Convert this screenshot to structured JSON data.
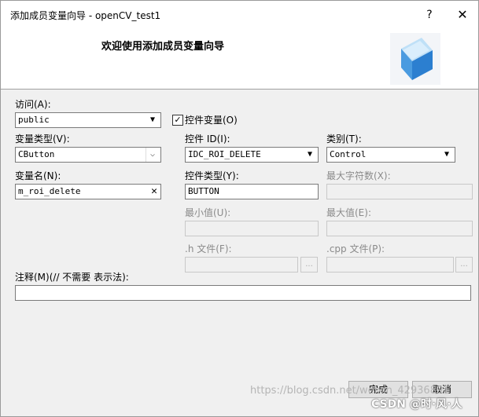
{
  "window": {
    "title": "添加成员变量向导 - openCV_test1",
    "help_label": "?",
    "close_label": "✕"
  },
  "header": {
    "title": "欢迎使用添加成员变量向导",
    "image_icon": "wizard-cube-icon"
  },
  "form": {
    "access": {
      "label": "访问(A):",
      "value": "public"
    },
    "control_variable": {
      "label": "控件变量(O)",
      "checked": true
    },
    "variable_type": {
      "label": "变量类型(V):",
      "value": "CButton"
    },
    "control_id": {
      "label": "控件 ID(I):",
      "value": "IDC_ROI_DELETE"
    },
    "category": {
      "label": "类别(T):",
      "value": "Control"
    },
    "variable_name": {
      "label": "变量名(N):",
      "value": "m_roi_delete"
    },
    "control_type": {
      "label": "控件类型(Y):",
      "value": "BUTTON"
    },
    "max_chars": {
      "label": "最大字符数(X):",
      "value": ""
    },
    "min_value": {
      "label": "最小值(U):",
      "value": ""
    },
    "max_value": {
      "label": "最大值(E):",
      "value": ""
    },
    "h_file": {
      "label": ".h 文件(F):",
      "value": "",
      "browse_label": "..."
    },
    "cpp_file": {
      "label": ".cpp 文件(P):",
      "value": "",
      "browse_label": "..."
    },
    "comment": {
      "label": "注释(M)(// 不需要 表示法):",
      "value": ""
    }
  },
  "footer": {
    "finish_label": "完成",
    "cancel_label": "取消"
  },
  "watermark": {
    "url_text": "https://blog.csdn.net/weixin_42936891",
    "brand_text": "CSDN @时·风·人"
  }
}
